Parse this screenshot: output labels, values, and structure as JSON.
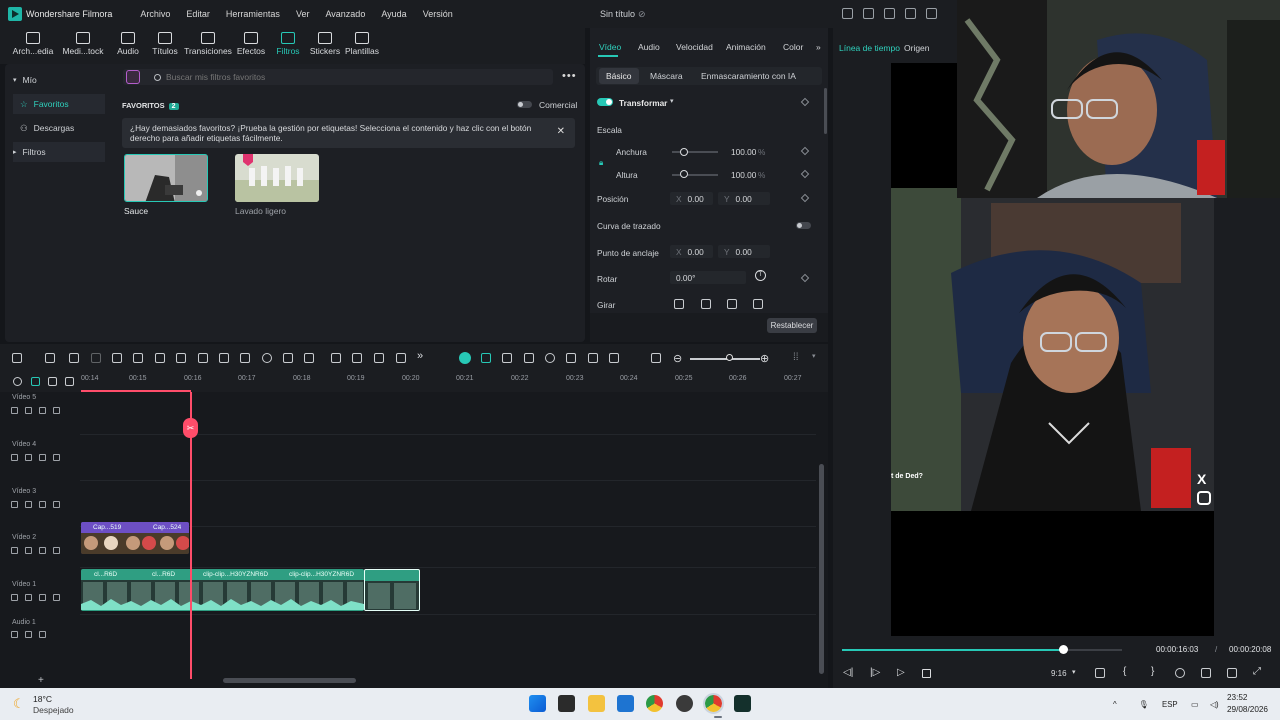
{
  "titlebar": {
    "app_name": "Wondershare Filmora",
    "menu": [
      "Archivo",
      "Editar",
      "Herramientas",
      "Ver",
      "Avanzado",
      "Ayuda",
      "Versión"
    ],
    "doc_title": "Sin título"
  },
  "toolbar": {
    "items": [
      "Arch...edia",
      "Medi...tock",
      "Audio",
      "Títulos",
      "Transiciones",
      "Efectos",
      "Filtros",
      "Stickers",
      "Plantillas"
    ],
    "active": "Filtros"
  },
  "library": {
    "sidebar": [
      "Mío",
      "Favoritos",
      "Descargas",
      "Filtros"
    ],
    "search_placeholder": "Buscar mis filtros favoritos",
    "favorites_label": "FAVORITOS",
    "favorites_count": "2",
    "commercial_label": "Comercial",
    "notice": "¿Hay demasiados favoritos? ¡Prueba la gestión por etiquetas! Selecciona el contenido y haz clic con el botón derecho para añadir etiquetas fácilmente.",
    "filters": [
      {
        "name": "Sauce"
      },
      {
        "name": "Lavado ligero"
      }
    ]
  },
  "properties": {
    "tabs": [
      "Vídeo",
      "Audio",
      "Velocidad",
      "Animación",
      "Color"
    ],
    "subtabs": [
      "Básico",
      "Máscara",
      "Enmascaramiento con IA"
    ],
    "transform_label": "Transformar",
    "scale_label": "Escala",
    "width_label": "Anchura",
    "width_value": "100.00",
    "height_label": "Altura",
    "height_value": "100.00",
    "percent": "%",
    "position_label": "Posición",
    "pos_x": "0.00",
    "pos_y": "0.00",
    "path_curve_label": "Curva de trazado",
    "anchor_label": "Punto de anclaje",
    "anchor_x": "0.00",
    "anchor_y": "0.00",
    "rotate_label": "Rotar",
    "rotate_value": "0.00°",
    "flip_label": "Girar",
    "reset_label": "Restablecer",
    "x": "X",
    "y": "Y"
  },
  "preview": {
    "tabs": [
      "Línea de tiempo",
      "Origen"
    ],
    "overlay_text": "t de Ded?",
    "current_time": "00:00:16:03",
    "separator": "/",
    "total_time": "00:00:20:08",
    "aspect": "9:16",
    "progress": 0.79
  },
  "timeline": {
    "ruler": [
      "00:14",
      "00:15",
      "00:16",
      "00:17",
      "00:18",
      "00:19",
      "00:20",
      "00:21",
      "00:22",
      "00:23",
      "00:24",
      "00:25",
      "00:26",
      "00:27"
    ],
    "tracks": [
      "Vídeo 5",
      "Vídeo 4",
      "Vídeo 3",
      "Vídeo 2",
      "Vídeo 1",
      "Audio 1"
    ],
    "caption_clips": [
      "Cap...519",
      "Cap...524"
    ],
    "video_clips": [
      "cl...R6D",
      "cl...R6D",
      "clip-clip...H30YZNR6D",
      "clip-clip...H30YZNR6D"
    ]
  },
  "taskbar": {
    "temperature": "18°C",
    "weather": "Despejado",
    "language": "ESP",
    "time": "23:52",
    "date": "29/08/2026"
  },
  "colors": {
    "accent": "#27c8b6",
    "playhead": "#ff4d6a",
    "caption_clip": "#6d4fc4",
    "video_clip": "#2f9e82"
  }
}
